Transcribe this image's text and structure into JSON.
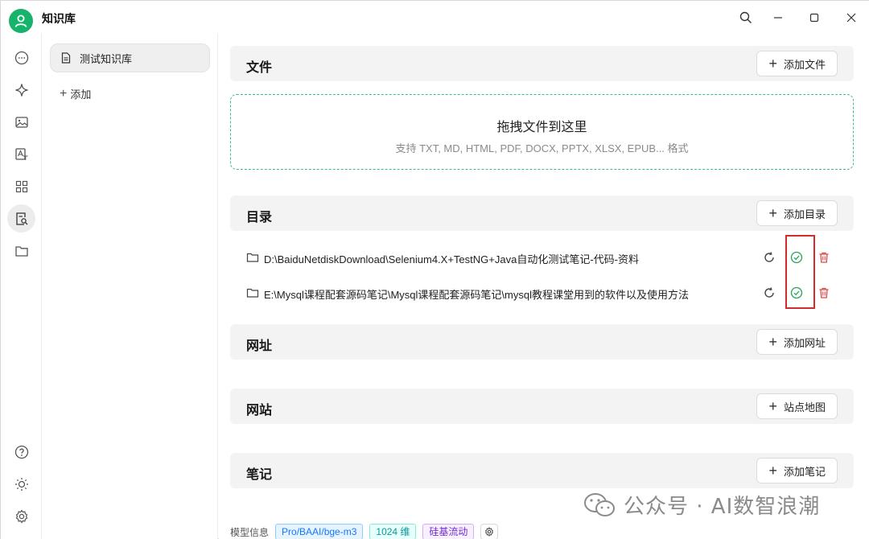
{
  "app": {
    "title": "知识库"
  },
  "colors": {
    "accent": "#16b36b",
    "highlight": "#d42c2c",
    "delete": "#e04848"
  },
  "rail": {
    "top_items": [
      "chat-icon",
      "sparkle-icon",
      "image-icon",
      "translate-icon",
      "grid-icon",
      "knowledge-search-icon",
      "folder-icon"
    ],
    "bottom_items": [
      "help-icon",
      "theme-sun-icon",
      "settings-icon"
    ],
    "active": "knowledge-search-icon"
  },
  "kb": {
    "items": [
      {
        "label": "测试知识库"
      }
    ],
    "add_label": "添加"
  },
  "sections": {
    "files": {
      "title": "文件",
      "button": "添加文件"
    },
    "dropzone": {
      "title": "拖拽文件到这里",
      "subtitle": "支持 TXT, MD, HTML, PDF, DOCX, PPTX, XLSX, EPUB... 格式"
    },
    "directories": {
      "title": "目录",
      "button": "添加目录",
      "items": [
        {
          "path": "D:\\BaiduNetdiskDownload\\Selenium4.X+TestNG+Java自动化测试笔记-代码-资料"
        },
        {
          "path": "E:\\Mysql课程配套源码笔记\\Mysql课程配套源码笔记\\mysql教程课堂用到的软件以及使用方法"
        }
      ]
    },
    "urls": {
      "title": "网址",
      "button": "添加网址"
    },
    "sites": {
      "title": "网站",
      "button": "站点地图"
    },
    "notes": {
      "title": "笔记",
      "button": "添加笔记"
    }
  },
  "footer": {
    "label": "模型信息",
    "tags": [
      "Pro/BAAI/bge-m3",
      "1024 维",
      "硅基流动"
    ]
  },
  "watermark": {
    "text": "公众号 · AI数智浪潮"
  }
}
